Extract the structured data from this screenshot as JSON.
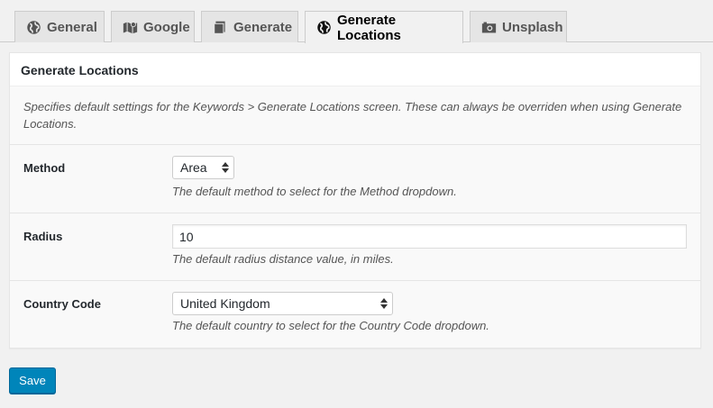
{
  "tabs": [
    {
      "label": "General",
      "icon": "globe-icon",
      "active": false
    },
    {
      "label": "Google",
      "icon": "map-icon",
      "active": false
    },
    {
      "label": "Generate",
      "icon": "book-icon",
      "active": false
    },
    {
      "label": "Generate Locations",
      "icon": "globe-icon",
      "active": true
    },
    {
      "label": "Unsplash",
      "icon": "camera-icon",
      "active": false
    }
  ],
  "panel": {
    "title": "Generate Locations",
    "description": "Specifies default settings for the Keywords > Generate Locations screen. These can always be overriden when using Generate Locations."
  },
  "fields": {
    "method": {
      "label": "Method",
      "value": "Area",
      "help": "The default method to select for the Method dropdown."
    },
    "radius": {
      "label": "Radius",
      "value": "10",
      "help": "The default radius distance value, in miles."
    },
    "country_code": {
      "label": "Country Code",
      "value": "United Kingdom",
      "help": "The default country to select for the Country Code dropdown."
    }
  },
  "save_label": "Save",
  "colors": {
    "primary_button": "#0085ba",
    "page_background": "#f1f1f1",
    "panel_background": "#ffffff"
  }
}
